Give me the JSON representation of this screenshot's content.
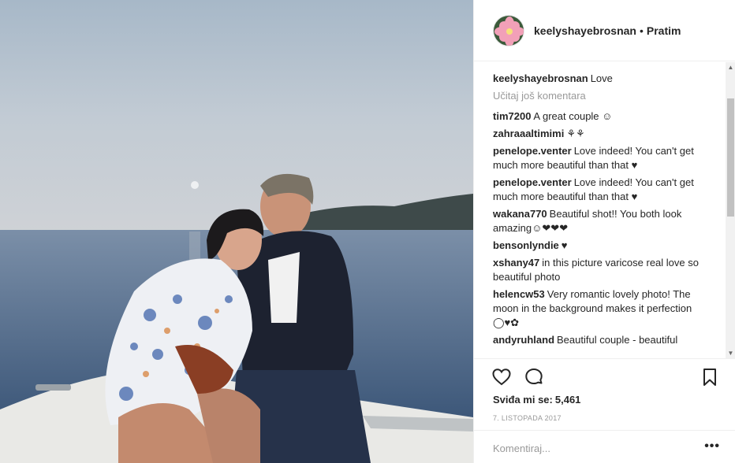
{
  "post": {
    "photo_alt_icon": "photo-couple-on-boat"
  },
  "header": {
    "username": "keelyshayebrosnan",
    "separator": "•",
    "follow_label": "Pratim"
  },
  "caption": {
    "username": "keelyshayebrosnan",
    "text": "Love"
  },
  "load_more_label": "Učitaj još komentara",
  "comments": [
    {
      "user": "tim7200",
      "text": "A great couple ☺"
    },
    {
      "user": "zahraaaltimimi",
      "text": "⚘⚘"
    },
    {
      "user": "penelope.venter",
      "text": "Love indeed! You can't get much more beautiful than that ♥"
    },
    {
      "user": "penelope.venter",
      "text": "Love indeed! You can't get much more beautiful than that ♥"
    },
    {
      "user": "wakana770",
      "text": "Beautiful shot!! You both look amazing☺❤❤❤"
    },
    {
      "user": "bensonlyndie",
      "text": "♥"
    },
    {
      "user": "xshany47",
      "text": "in this picture varicose real love so beautiful photo"
    },
    {
      "user": "helencw53",
      "text": "Very romantic lovely photo! The moon in the background makes it perfection ◯♥✿"
    },
    {
      "user": "andyruhland",
      "text": "Beautiful couple - beautiful"
    }
  ],
  "scroll_up_glyph": "▲",
  "scroll_down_glyph": "▼",
  "likes": {
    "label": "Sviđa mi se:",
    "count": "5,461"
  },
  "date": "7. listopada 2017",
  "comment_box": {
    "placeholder": "Komentiraj...",
    "more_glyph": "•••"
  },
  "colors": {
    "text": "#262626",
    "muted": "#999999",
    "border": "#efefef"
  }
}
